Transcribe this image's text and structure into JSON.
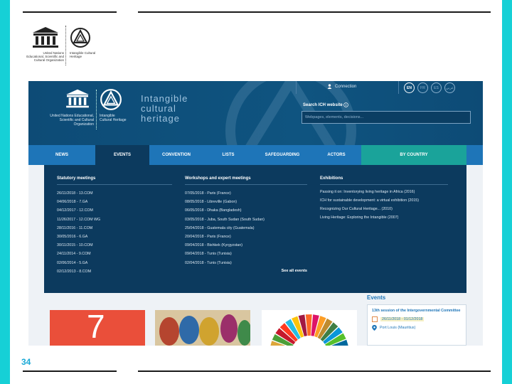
{
  "page_number": "34",
  "slide_logo": {
    "org_text": "United Nations Educational, Scientific and Cultural Organization",
    "ich_text": "Intangible Cultural Heritage"
  },
  "site": {
    "title": "Intangible\ncultural\nheritage",
    "org_text": "United Nations Educational, Scientific and Cultural Organization",
    "ich_text": "Intangible Cultural Heritage",
    "connection_label": "Connection",
    "languages": [
      {
        "code": "EN",
        "active": true
      },
      {
        "code": "FR",
        "active": false
      },
      {
        "code": "ES",
        "active": false
      },
      {
        "code": "عربي",
        "active": false
      }
    ],
    "search_label": "Search ICH website",
    "search_placeholder": "Webpages, elements, decisions..."
  },
  "nav": [
    {
      "label": "NEWS"
    },
    {
      "label": "EVENTS",
      "active": true
    },
    {
      "label": "CONVENTION"
    },
    {
      "label": "LISTS"
    },
    {
      "label": "SAFEGUARDING"
    },
    {
      "label": "ACTORS"
    },
    {
      "label": "BY COUNTRY"
    }
  ],
  "mega_menu": {
    "statutory": {
      "title": "Statutory meetings",
      "items": [
        "26/11/2018 - 13.COM",
        "04/06/2018 - 7.GA",
        "04/12/2017 - 12.COM",
        "11/26/2017 - 12.COM WG",
        "28/11/2016 - 11.COM",
        "30/05/2016 - 6.GA",
        "30/11/2015 - 10.COM",
        "24/11/2014 - 9.COM",
        "02/06/2014 - 5.GA",
        "02/12/2013 - 8.COM"
      ]
    },
    "workshops": {
      "title": "Workshops and expert meetings",
      "items": [
        "07/05/2018 - Paris (France)",
        "08/05/2018 - Libreville (Gabon)",
        "06/05/2018 - Dhaka (Bangladesh)",
        "03/05/2018 - Juba, South Sudan (South Sudan)",
        "25/04/2018 - Guatemala city (Guatemala)",
        "20/04/2018 - Paris (France)",
        "09/04/2018 - Bishkek (Kyrgyzstan)",
        "09/04/2018 - Tunis (Tunisia)",
        "02/04/2018 - Tunis (Tunisia)"
      ],
      "see_all": "See all events"
    },
    "exhibitions": {
      "title": "Exhibitions",
      "items": [
        "Passing it on: Inventorying living heritage in Africa (2016)",
        "ICH for sustainable development: a virtual exhibition (2015)",
        "Recognizing Our Cultural Heritage... (2010)",
        "Living Heritage: Exploring the Intangible (2007)"
      ]
    }
  },
  "tiles": {
    "first_number": "7"
  },
  "events": {
    "heading": "Events",
    "item_title": "13th session of the Intergovernmental Committee",
    "dates": "26/11/2018 - 01/12/2018",
    "location": "Port Louis (Mauritius)"
  },
  "colors": {
    "frame": "#16d0d6",
    "header": "#0d4b76",
    "nav": "#1e75b8",
    "mega_menu": "#0c3a5e",
    "country_tab": "#1aa39a",
    "page_number": "#1aa9d6"
  }
}
